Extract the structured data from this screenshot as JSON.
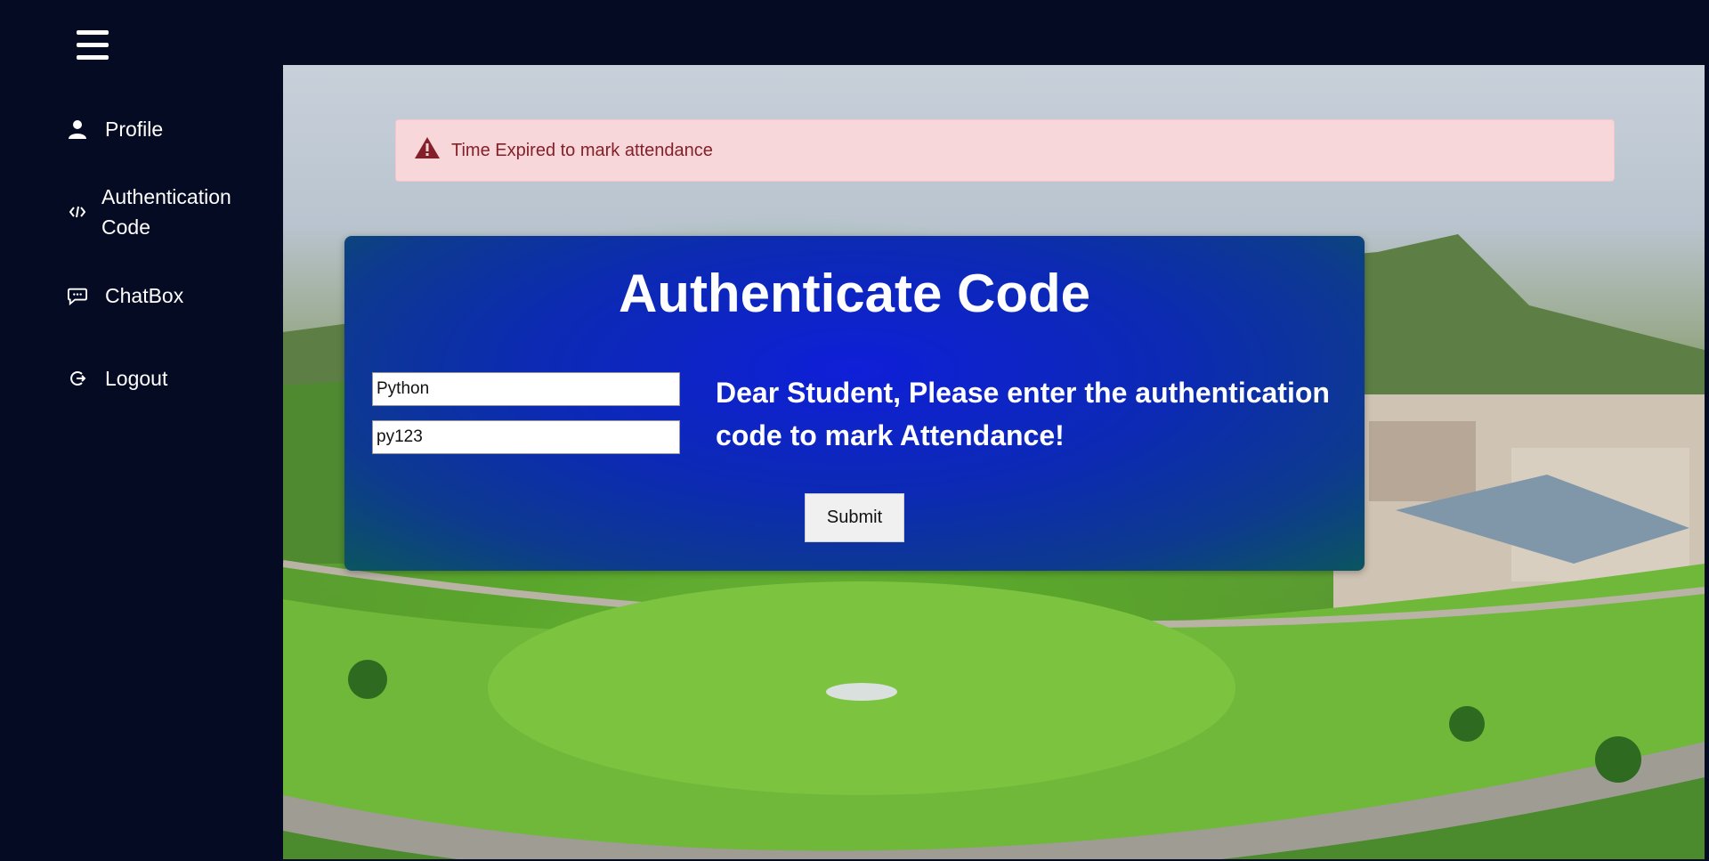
{
  "sidebar": {
    "menu_icon": "hamburger-icon",
    "items": [
      {
        "label": "Profile",
        "icon": "user-icon"
      },
      {
        "label": "Authentication\nCode",
        "icon": "code-icon"
      },
      {
        "label": "ChatBox",
        "icon": "chat-icon"
      },
      {
        "label": "Logout",
        "icon": "logout-icon"
      }
    ]
  },
  "alert": {
    "icon": "warning-icon",
    "message": "Time Expired to mark attendance",
    "background": "#f8d7da",
    "text_color": "#842029"
  },
  "card": {
    "title": "Authenticate Code",
    "subject_value": "Python",
    "code_value": "py123",
    "message": "Dear Student, Please enter the authentication code to mark Attendance!",
    "submit_label": "Submit"
  },
  "colors": {
    "sidebar_bg": "#050b22",
    "card_accent": "#0f1fd8"
  }
}
